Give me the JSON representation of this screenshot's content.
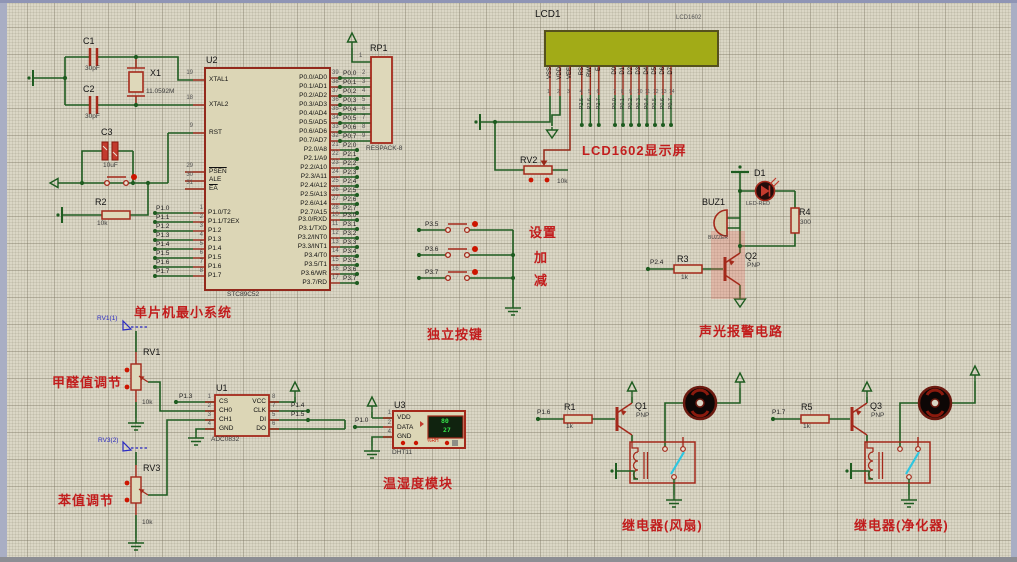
{
  "labels": {
    "mcu_system": "单片机最小系统",
    "lcd_screen": "LCD1602显示屏",
    "keys_title": "独立按键",
    "alarm_title": "声光报警电路",
    "dht_title": "温湿度模块",
    "fan_title": "继电器(风扇)",
    "purifier_title": "继电器(净化器)",
    "formaldehyde": "甲醛值调节",
    "benzene": "苯值调节"
  },
  "xtal": {
    "c1_ref": "C1",
    "c1_val": "30pF",
    "c2_ref": "C2",
    "c2_val": "30pF",
    "x1_ref": "X1",
    "x1_val": "11.0592M",
    "c3_ref": "C3",
    "c3_val": "10uF",
    "r2_ref": "R2",
    "r2_val": "10k"
  },
  "mcu": {
    "ref": "U2",
    "part": "STC89C52",
    "left_singles": [
      {
        "num": "19",
        "name": "XTAL1"
      },
      {
        "num": "18",
        "name": "XTAL2"
      },
      {
        "num": "9",
        "name": "RST"
      },
      {
        "num": "29",
        "name": "PSEN"
      },
      {
        "num": "30",
        "name": "ALE"
      },
      {
        "num": "31",
        "name": "EA"
      }
    ],
    "p1": [
      {
        "num": "1",
        "name": "P1.0/T2",
        "net": "P1.0"
      },
      {
        "num": "2",
        "name": "P1.1/T2EX",
        "net": "P1.1"
      },
      {
        "num": "3",
        "name": "P1.2",
        "net": "P1.2"
      },
      {
        "num": "4",
        "name": "P1.3",
        "net": "P1.3"
      },
      {
        "num": "5",
        "name": "P1.4",
        "net": "P1.4"
      },
      {
        "num": "6",
        "name": "P1.5",
        "net": "P1.5"
      },
      {
        "num": "7",
        "name": "P1.6",
        "net": "P1.6"
      },
      {
        "num": "8",
        "name": "P1.7",
        "net": "P1.7"
      }
    ],
    "p0": [
      {
        "num": "39",
        "name": "P0.0/AD0",
        "net": "P0.0"
      },
      {
        "num": "38",
        "name": "P0.1/AD1",
        "net": "P0.1"
      },
      {
        "num": "37",
        "name": "P0.2/AD2",
        "net": "P0.2"
      },
      {
        "num": "36",
        "name": "P0.3/AD3",
        "net": "P0.3"
      },
      {
        "num": "35",
        "name": "P0.4/AD4",
        "net": "P0.4"
      },
      {
        "num": "34",
        "name": "P0.5/AD5",
        "net": "P0.5"
      },
      {
        "num": "33",
        "name": "P0.6/AD6",
        "net": "P0.6"
      },
      {
        "num": "32",
        "name": "P0.7/AD7",
        "net": "P0.7"
      }
    ],
    "p2": [
      {
        "num": "21",
        "name": "P2.0/A8",
        "net": "P2.0"
      },
      {
        "num": "22",
        "name": "P2.1/A9",
        "net": "P2.1"
      },
      {
        "num": "23",
        "name": "P2.2/A10",
        "net": "P2.2"
      },
      {
        "num": "24",
        "name": "P2.3/A11",
        "net": "P2.3"
      },
      {
        "num": "25",
        "name": "P2.4/A12",
        "net": "P2.4"
      },
      {
        "num": "26",
        "name": "P2.5/A13",
        "net": "P2.5"
      },
      {
        "num": "27",
        "name": "P2.6/A14",
        "net": "P2.6"
      },
      {
        "num": "28",
        "name": "P2.7/A15",
        "net": "P2.7"
      }
    ],
    "p3": [
      {
        "num": "10",
        "name": "P3.0/RXD",
        "net": "P3.0"
      },
      {
        "num": "11",
        "name": "P3.1/TXD",
        "net": "P3.1"
      },
      {
        "num": "12",
        "name": "P3.2/INT0",
        "net": "P3.2"
      },
      {
        "num": "13",
        "name": "P3.3/INT1",
        "net": "P3.3"
      },
      {
        "num": "14",
        "name": "P3.4/T0",
        "net": "P3.4"
      },
      {
        "num": "15",
        "name": "P3.5/T1",
        "net": "P3.5"
      },
      {
        "num": "16",
        "name": "P3.6/WR",
        "net": "P3.6"
      },
      {
        "num": "17",
        "name": "P3.7/RD",
        "net": "P3.7"
      }
    ]
  },
  "rp1": {
    "ref": "RP1",
    "part": "RESPACK-8",
    "pin1": "1",
    "pin_nums": [
      "2",
      "3",
      "4",
      "5",
      "6",
      "7",
      "8",
      "9"
    ]
  },
  "lcd": {
    "ref": "LCD1",
    "part": "LCD1602",
    "power_pins": [
      {
        "num": "1",
        "name": "VSS",
        "net": ""
      },
      {
        "num": "2",
        "name": "VDD",
        "net": ""
      },
      {
        "num": "3",
        "name": "VEE",
        "net": ""
      }
    ],
    "ctrl_pins": [
      {
        "num": "4",
        "name": "RS",
        "net": "P2.5"
      },
      {
        "num": "5",
        "name": "RW",
        "net": "P2.6"
      },
      {
        "num": "6",
        "name": "E",
        "net": "P2.7"
      }
    ],
    "data_pins": [
      {
        "num": "7",
        "name": "D0",
        "net": "P0.0"
      },
      {
        "num": "8",
        "name": "D1",
        "net": "P0.1"
      },
      {
        "num": "9",
        "name": "D2",
        "net": "P0.2"
      },
      {
        "num": "10",
        "name": "D3",
        "net": "P0.3"
      },
      {
        "num": "11",
        "name": "D4",
        "net": "P0.4"
      },
      {
        "num": "12",
        "name": "D5",
        "net": "P0.5"
      },
      {
        "num": "13",
        "name": "D6",
        "net": "P0.6"
      },
      {
        "num": "14",
        "name": "D7",
        "net": "P0.7"
      }
    ],
    "rv2_ref": "RV2",
    "rv2_val": "10k"
  },
  "keys": {
    "items": [
      {
        "net": "P3.5",
        "label": "设置"
      },
      {
        "net": "P3.6",
        "label": "加"
      },
      {
        "net": "P3.7",
        "label": "减"
      }
    ]
  },
  "alarm": {
    "net": "P2.4",
    "d1_ref": "D1",
    "d1_part": "LED-RED",
    "buz_ref": "BUZ1",
    "buz_part": "BUZZER",
    "r4_ref": "R4",
    "r4_val": "300",
    "r3_ref": "R3",
    "r3_val": "1k",
    "q2_ref": "Q2",
    "q2_type": "PNP"
  },
  "pots": {
    "rv1_ref": "RV1",
    "rv1_val": "10k",
    "rv1_probe": "RV1(1)",
    "rv3_ref": "RV3",
    "rv3_val": "10k",
    "rv3_probe": "RV3(2)"
  },
  "adc": {
    "ref": "U1",
    "part": "ADC0832",
    "left": [
      {
        "num": "1",
        "name": "CS"
      },
      {
        "num": "2",
        "name": "CH0"
      },
      {
        "num": "3",
        "name": "CH1"
      },
      {
        "num": "4",
        "name": "GND"
      }
    ],
    "right": [
      {
        "num": "8",
        "name": "VCC"
      },
      {
        "num": "7",
        "name": "CLK"
      },
      {
        "num": "5",
        "name": "DI"
      },
      {
        "num": "6",
        "name": "DO"
      }
    ],
    "net_cs": "P1.3",
    "net_clk": "P1.4",
    "net_data": "P1.5"
  },
  "dht": {
    "ref": "U3",
    "part": "DHT11",
    "net": "P1.0",
    "pins": [
      {
        "num": "1",
        "name": "VDD"
      },
      {
        "num": "2",
        "name": "DATA"
      },
      {
        "num": "4",
        "name": "GND"
      }
    ],
    "humidity": "80",
    "temperature": "27",
    "unit": "%RH"
  },
  "fan": {
    "net": "P1.6",
    "r_ref": "R1",
    "r_val": "1k",
    "q_ref": "Q1",
    "q_type": "PNP"
  },
  "purifier": {
    "net": "P1.7",
    "r_ref": "R5",
    "r_val": "1k",
    "q_ref": "Q3",
    "q_type": "PNP"
  }
}
